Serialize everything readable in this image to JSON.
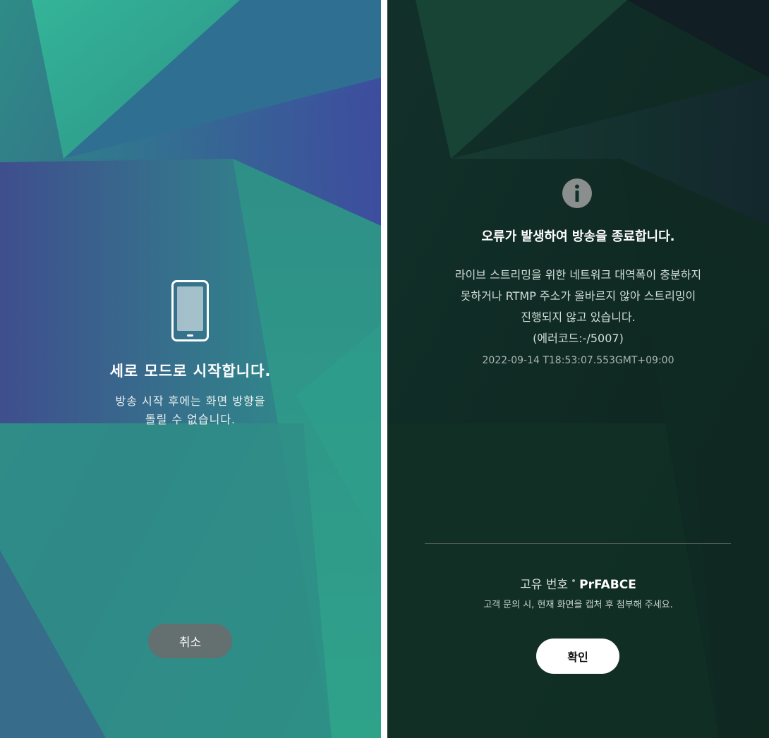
{
  "left_screen": {
    "title": "세로 모드로 시작합니다.",
    "description_line1": "방송 시작 후에는 화면 방향을",
    "description_line2": "돌릴 수 없습니다.",
    "cancel_label": "취소",
    "icon": "smartphone-portrait-icon"
  },
  "right_screen": {
    "icon": "info-icon",
    "title": "오류가 발생하여 방송을 종료합니다.",
    "message_line1": "라이브 스트리밍을 위한 네트워크 대역폭이 충분하지",
    "message_line2": "못하거나 RTMP 주소가 올바르지 않아 스트리밍이",
    "message_line3": "진행되지 않고 있습니다.",
    "error_code": "(에러코드:-/5007)",
    "timestamp": "2022-09-14 T18:53:07.553GMT+09:00",
    "unique_id_label": "고유 번호",
    "unique_id_value": "PrFABCE",
    "support_note": "고객 문의 시, 현재 화면을 캡처 후 첨부해 주세요.",
    "confirm_label": "확인"
  },
  "colors": {
    "left_teal": "#2f9a84",
    "left_indigo": "#3d4f8c",
    "right_bg": "#0f2a22",
    "cancel_bg": "#696c6e",
    "confirm_bg": "#ffffff"
  }
}
